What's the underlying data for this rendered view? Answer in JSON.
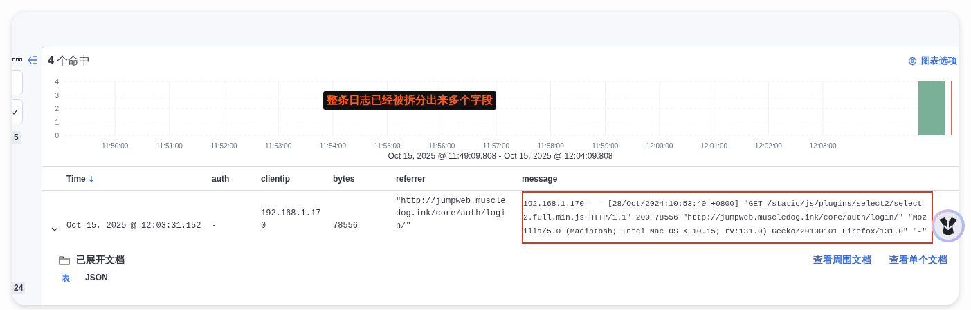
{
  "sidebar": {
    "cards": [
      {
        "checked": false
      },
      {
        "checked": true
      }
    ],
    "badges": [
      "5",
      "24"
    ]
  },
  "hits": {
    "count": "4",
    "label": "个命中"
  },
  "chart_options_link": "图表选项",
  "histogram": {
    "chart_data": {
      "type": "bar",
      "categories": [
        "11:50:00",
        "11:51:00",
        "11:52:00",
        "11:53:00",
        "11:54:00",
        "11:55:00",
        "11:56:00",
        "11:57:00",
        "11:58:00",
        "11:59:00",
        "12:00:00",
        "12:01:00",
        "12:02:00",
        "12:03:00",
        null,
        null
      ],
      "series": [
        {
          "color": "#79b097",
          "values": [
            0,
            0,
            0,
            0,
            0,
            0,
            0,
            0,
            0,
            0,
            0,
            0,
            0,
            0,
            0,
            4
          ]
        }
      ],
      "ylim": [
        0,
        4
      ],
      "yticks": [
        0,
        1,
        2,
        3,
        4
      ],
      "grid": true
    },
    "time_range": "Oct 15, 2025 @ 11:49:09.808 - Oct 15, 2025 @ 12:04:09.808"
  },
  "callout": "整条日志已经被拆分出来多个字段",
  "table": {
    "columns": [
      {
        "label": "Time",
        "sorted": true
      },
      {
        "label": "auth",
        "sorted": false
      },
      {
        "label": "clientip",
        "sorted": false
      },
      {
        "label": "bytes",
        "sorted": false
      },
      {
        "label": "referrer",
        "sorted": false
      },
      {
        "label": "message",
        "sorted": false
      }
    ],
    "rows": [
      {
        "expanded": true,
        "cells": [
          {
            "text": "Oct 15, 2025 @ 12:03:31.152",
            "highlighted": false
          },
          {
            "text": "-",
            "highlighted": false
          },
          {
            "text": "192.168.1.170",
            "highlighted": false
          },
          {
            "text": "78556",
            "highlighted": false
          },
          {
            "text": "\"http://jumpweb.muscledog.ink/core/auth/login/\"",
            "highlighted": false
          },
          {
            "text": "192.168.1.170 - - [28/Oct/2024:10:53:40 +0800] \"GET /static/js/plugins/select2/select2.full.min.js HTTP/1.1\" 200 78556 \"http://jumpweb.muscledog.ink/core/auth/login/\" \"Mozilla/5.0 (Macintosh; Intel Mac OS X 10.15; rv:131.0) Gecko/20100101 Firefox/131.0\" \"-\"",
            "highlighted": true
          }
        ]
      }
    ]
  },
  "expanded_document": {
    "title": "已展开文档",
    "links": [
      "查看周围文档",
      "查看单个文档"
    ],
    "tabs": [
      {
        "label": "表",
        "selected": true
      },
      {
        "label": "JSON",
        "selected": false
      }
    ]
  }
}
